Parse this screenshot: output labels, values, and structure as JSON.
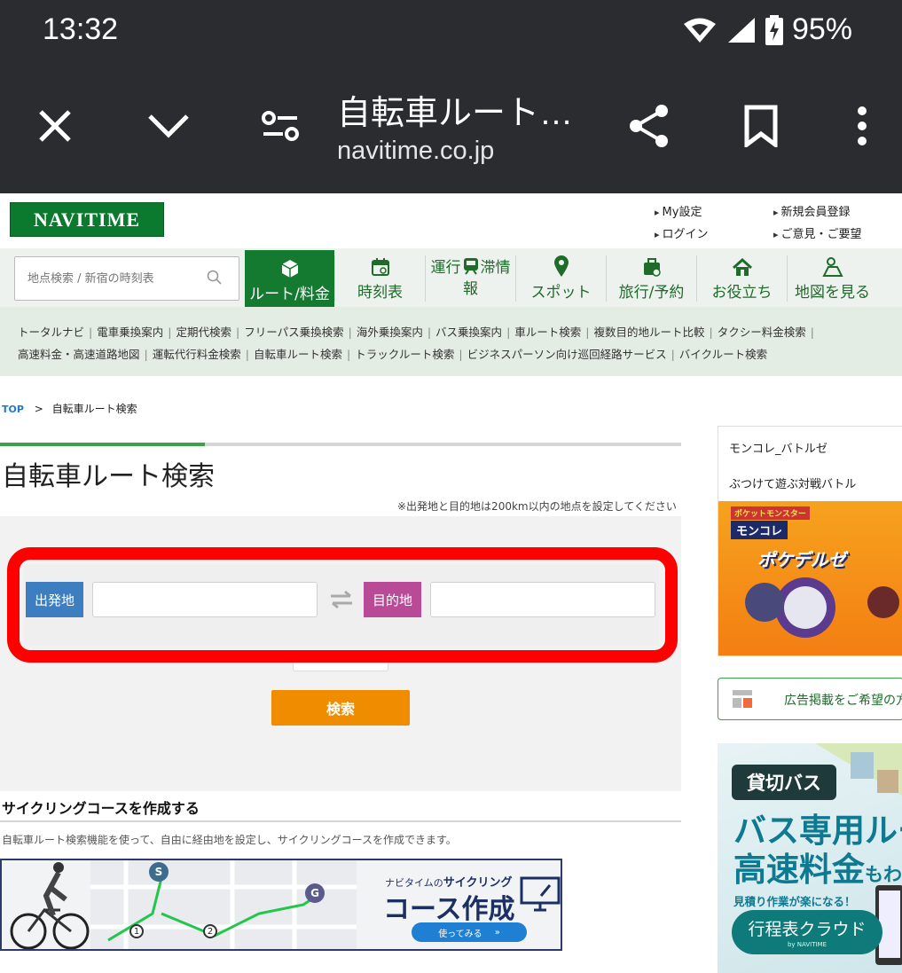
{
  "status": {
    "time": "13:32",
    "battery": "95%"
  },
  "browser": {
    "title": "自転車ルート…",
    "url": "navitime.co.jp"
  },
  "header": {
    "logo": "NAVITIME",
    "links": [
      "My設定",
      "新規会員登録",
      "ログイン",
      "ご意見・ご要望"
    ]
  },
  "search": {
    "placeholder": "地点検索 / 新宿の時刻表"
  },
  "nav": [
    {
      "label": "ルート/料金",
      "icon": "route-box-icon",
      "active": true
    },
    {
      "label": "時刻表",
      "icon": "calendar-icon"
    },
    {
      "label_top": "運行",
      "label_overlay": "滞情",
      "label_bottom": "報",
      "icon": "train-icon"
    },
    {
      "label": "スポット",
      "icon": "pin-icon"
    },
    {
      "label": "旅行/予約",
      "icon": "suitcase-icon"
    },
    {
      "label": "お役立ち",
      "icon": "house-icon"
    },
    {
      "label": "地図を見る",
      "icon": "map-person-icon"
    }
  ],
  "sublinks": [
    [
      "トータルナビ",
      "電車乗換案内",
      "定期代検索",
      "フリーパス乗換検索",
      "海外乗換案内",
      "バス乗換案内",
      "車ルート検索",
      "複数目的地ルート比較",
      "タクシー料金検索",
      ""
    ],
    [
      "高速料金・高速道路地図",
      "運転代行料金検索",
      "自転車ルート検索",
      "トラックルート検索",
      "ビジネスパーソン向け巡回経路サービス",
      "バイクルート検索"
    ]
  ],
  "breadcrumb": {
    "top": "TOP",
    "sep": ">",
    "current": "自転車ルート検索"
  },
  "page": {
    "title": "自転車ルート検索",
    "note": "※出発地と目的地は200km以内の地点を設定してください",
    "from_label": "出発地",
    "to_label": "目的地",
    "from_value": "",
    "to_value": "",
    "search_button": "検索"
  },
  "cycling": {
    "heading": "サイクリングコースを作成する",
    "desc": "自転車ルート検索機能を使って、自由に経由地を設定し、サイクリングコースを作成できます。",
    "banner_small_prefix": "ナビタイムの",
    "banner_small_em": "サイクリング",
    "banner_big": "コース作成",
    "banner_button": "使ってみる",
    "markers": [
      "S",
      "G",
      "1",
      "2"
    ]
  },
  "ads": {
    "ad1_title": "モンコレ_バトルゼ",
    "ad1_sub": "ぶつけて遊ぶ対戦バトル",
    "ad1_logo1": "ポケットモンスター",
    "ad1_logo2": "モンコレ",
    "ad1_logo3": "ポケデルゼ",
    "ad_inquiry": "広告掲載をご希望の方",
    "ad2_pill": "貸切バス",
    "ad2_big1": "バス専用ルート",
    "ad2_big2": "高速料金",
    "ad2_big2_suffix": "もわかる",
    "ad2_small": "見積り作業が楽になる！",
    "ad2_button": "行程表クラウド",
    "ad2_by": "by NAVITIME"
  }
}
